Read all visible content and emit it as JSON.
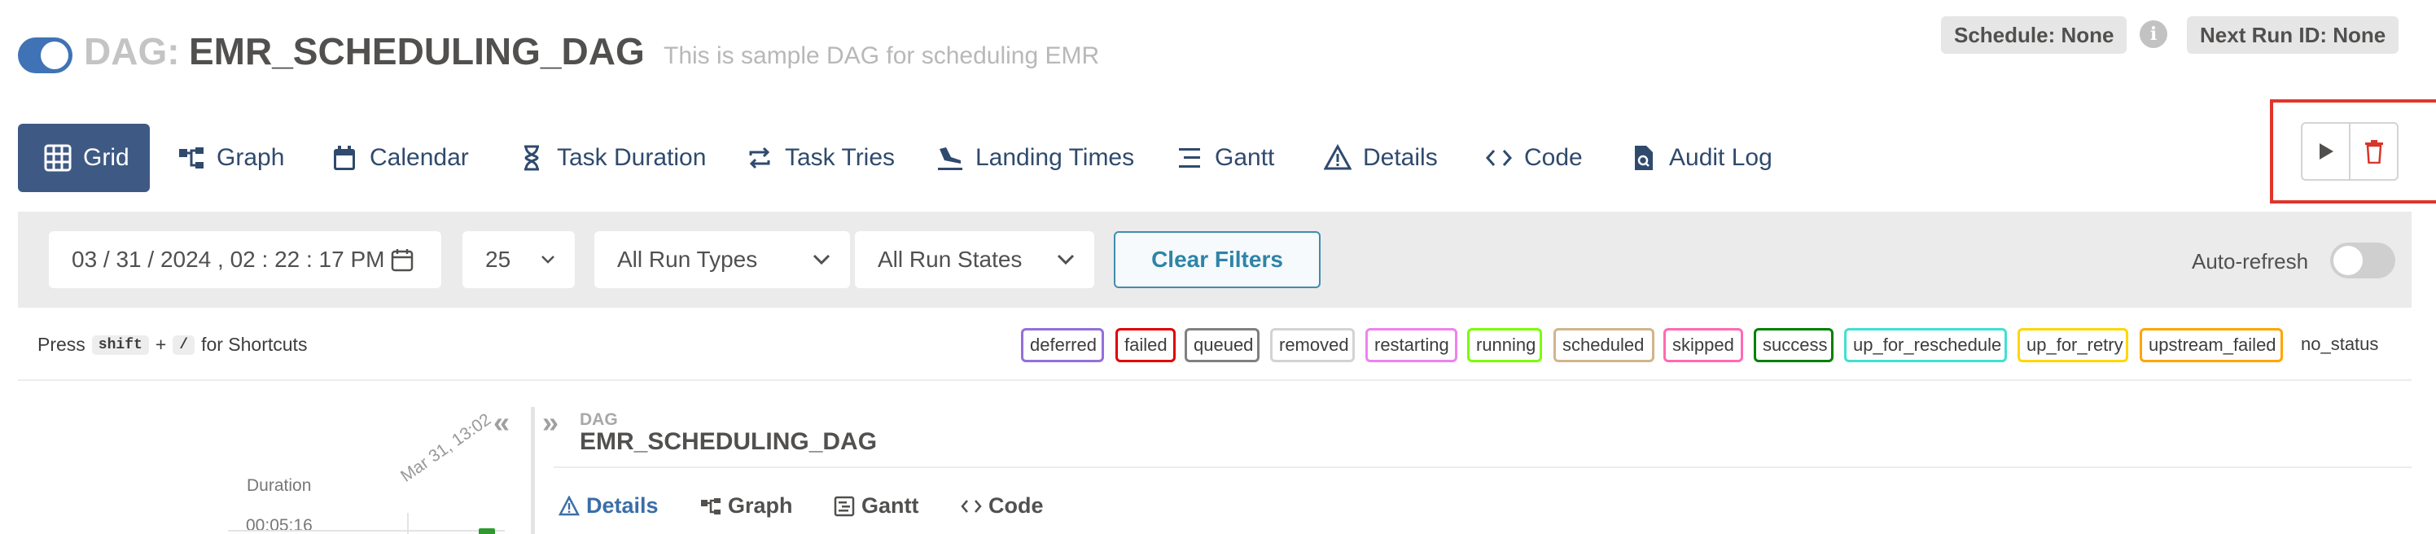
{
  "header": {
    "title_prefix": "DAG:",
    "dag_id": "EMR_SCHEDULING_DAG",
    "description": "This is sample DAG for scheduling EMR",
    "schedule": "Schedule: None",
    "next_run": "Next Run ID: None",
    "paused_toggle_on": true
  },
  "nav": {
    "tabs": [
      {
        "label": "Grid",
        "icon": "grid-icon"
      },
      {
        "label": "Graph",
        "icon": "graph-icon"
      },
      {
        "label": "Calendar",
        "icon": "calendar-icon"
      },
      {
        "label": "Task Duration",
        "icon": "hourglass-icon"
      },
      {
        "label": "Task Tries",
        "icon": "retry-icon"
      },
      {
        "label": "Landing Times",
        "icon": "plane-landing-icon"
      },
      {
        "label": "Gantt",
        "icon": "gantt-icon"
      },
      {
        "label": "Details",
        "icon": "warning-triangle-icon"
      },
      {
        "label": "Code",
        "icon": "code-icon"
      },
      {
        "label": "Audit Log",
        "icon": "document-search-icon"
      }
    ],
    "active": "Grid"
  },
  "filters": {
    "datetime": "03 / 31 / 2024 ,  02 : 22 : 17   PM",
    "num_runs": "25",
    "run_type": "All Run Types",
    "run_state": "All Run States",
    "clear_label": "Clear Filters",
    "auto_refresh_label": "Auto-refresh",
    "auto_refresh_on": false
  },
  "shortcuts": {
    "press": "Press",
    "key1": "shift",
    "plus": "+",
    "key2": "/",
    "suffix": "for Shortcuts"
  },
  "legend": [
    {
      "label": "deferred",
      "color": "#9370db"
    },
    {
      "label": "failed",
      "color": "#e00000"
    },
    {
      "label": "queued",
      "color": "#808080"
    },
    {
      "label": "removed",
      "color": "#d3d3d3"
    },
    {
      "label": "restarting",
      "color": "#ee82ee"
    },
    {
      "label": "running",
      "color": "#7cfc00"
    },
    {
      "label": "scheduled",
      "color": "#d2b48c"
    },
    {
      "label": "skipped",
      "color": "#ff69b4"
    },
    {
      "label": "success",
      "color": "#008000"
    },
    {
      "label": "up_for_reschedule",
      "color": "#40e0d0"
    },
    {
      "label": "up_for_retry",
      "color": "#ffd700"
    },
    {
      "label": "upstream_failed",
      "color": "#ffa500"
    },
    {
      "label": "no_status",
      "color": "#ffffff"
    }
  ],
  "grid": {
    "collapse_left": "«",
    "collapse_right": "»",
    "duration_label": "Duration",
    "duration_value": "00:05:16",
    "run_date": "Mar 31, 13:02",
    "run_state_color": "#2e9a2e"
  },
  "details": {
    "dag_label": "DAG",
    "dag_id": "EMR_SCHEDULING_DAG",
    "tabs": [
      {
        "label": "Details",
        "icon": "warning-triangle-icon"
      },
      {
        "label": "Graph",
        "icon": "graph-icon"
      },
      {
        "label": "Gantt",
        "icon": "gantt-icon"
      },
      {
        "label": "Code",
        "icon": "code-icon"
      }
    ],
    "active": "Details"
  },
  "colors": {
    "accent": "#3e5a84",
    "toggle_on": "#3f73b5",
    "highlight": "#e0352b",
    "trash": "#d9342b"
  }
}
